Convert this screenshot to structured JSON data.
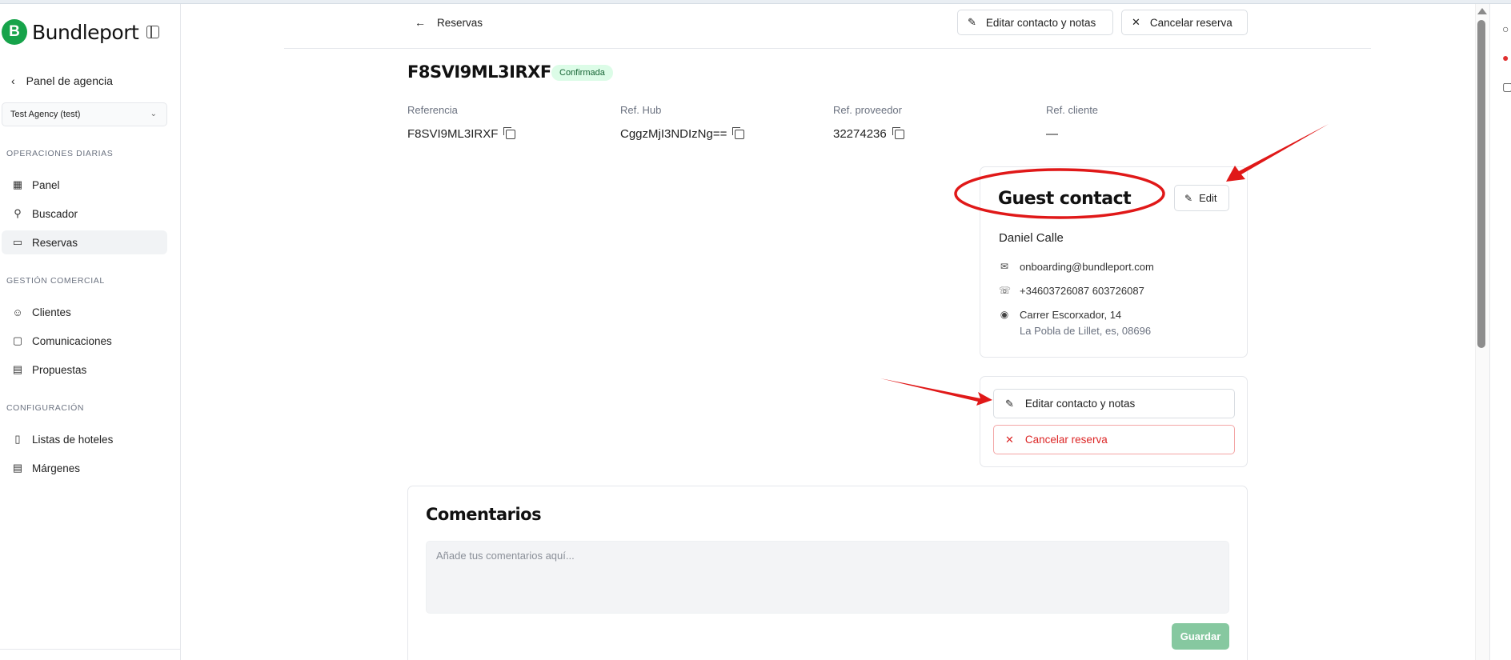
{
  "brand": {
    "logo_letter": "B",
    "name": "Bundleport"
  },
  "sidebar": {
    "back_label": "Panel de agencia",
    "agency_select": "Test Agency (test)",
    "sections": [
      {
        "title": "OPERACIONES DIARIAS"
      },
      {
        "title": "GESTIÓN COMERCIAL"
      },
      {
        "title": "CONFIGURACIÓN"
      }
    ],
    "items": [
      {
        "label": "Panel",
        "icon": "grid-icon"
      },
      {
        "label": "Buscador",
        "icon": "search-icon"
      },
      {
        "label": "Reservas",
        "icon": "calendar-icon",
        "active": true
      },
      {
        "label": "Clientes",
        "icon": "users-icon"
      },
      {
        "label": "Comunicaciones",
        "icon": "chat-icon"
      },
      {
        "label": "Propuestas",
        "icon": "document-icon"
      },
      {
        "label": "Listas de hoteles",
        "icon": "bookmark-icon"
      },
      {
        "label": "Márgenes",
        "icon": "document-icon"
      }
    ]
  },
  "topbar": {
    "back_label": "Reservas",
    "edit_label": "Editar contacto y notas",
    "cancel_label": "Cancelar reserva"
  },
  "reservation": {
    "code": "F8SVI9ML3IRXF",
    "status": "Confirmada",
    "refs": [
      {
        "label": "Referencia",
        "value": "F8SVI9ML3IRXF"
      },
      {
        "label": "Ref. Hub",
        "value": "CggzMjI3NDIzNg=="
      },
      {
        "label": "Ref. proveedor",
        "value": "32274236"
      },
      {
        "label": "Ref. cliente",
        "value": "—"
      }
    ]
  },
  "guest_contact": {
    "title": "Guest contact",
    "edit_label": "Edit",
    "name": "Daniel Calle",
    "email": "onboarding@bundleport.com",
    "phone": "+34603726087 603726087",
    "address_line1": "Carrer Escorxador, 14",
    "address_line2": "La Pobla de Lillet, es, 08696"
  },
  "actions": {
    "edit_label": "Editar contacto y notas",
    "cancel_label": "Cancelar reserva"
  },
  "comments": {
    "title": "Comentarios",
    "placeholder": "Añade tus comentarios aquí...",
    "save_label": "Guardar"
  },
  "colors": {
    "brand": "#16a34a",
    "badge_bg": "#dcfce7",
    "danger": "#dc2626",
    "save_bg": "#86c8a0",
    "annotation": "#e01818"
  }
}
